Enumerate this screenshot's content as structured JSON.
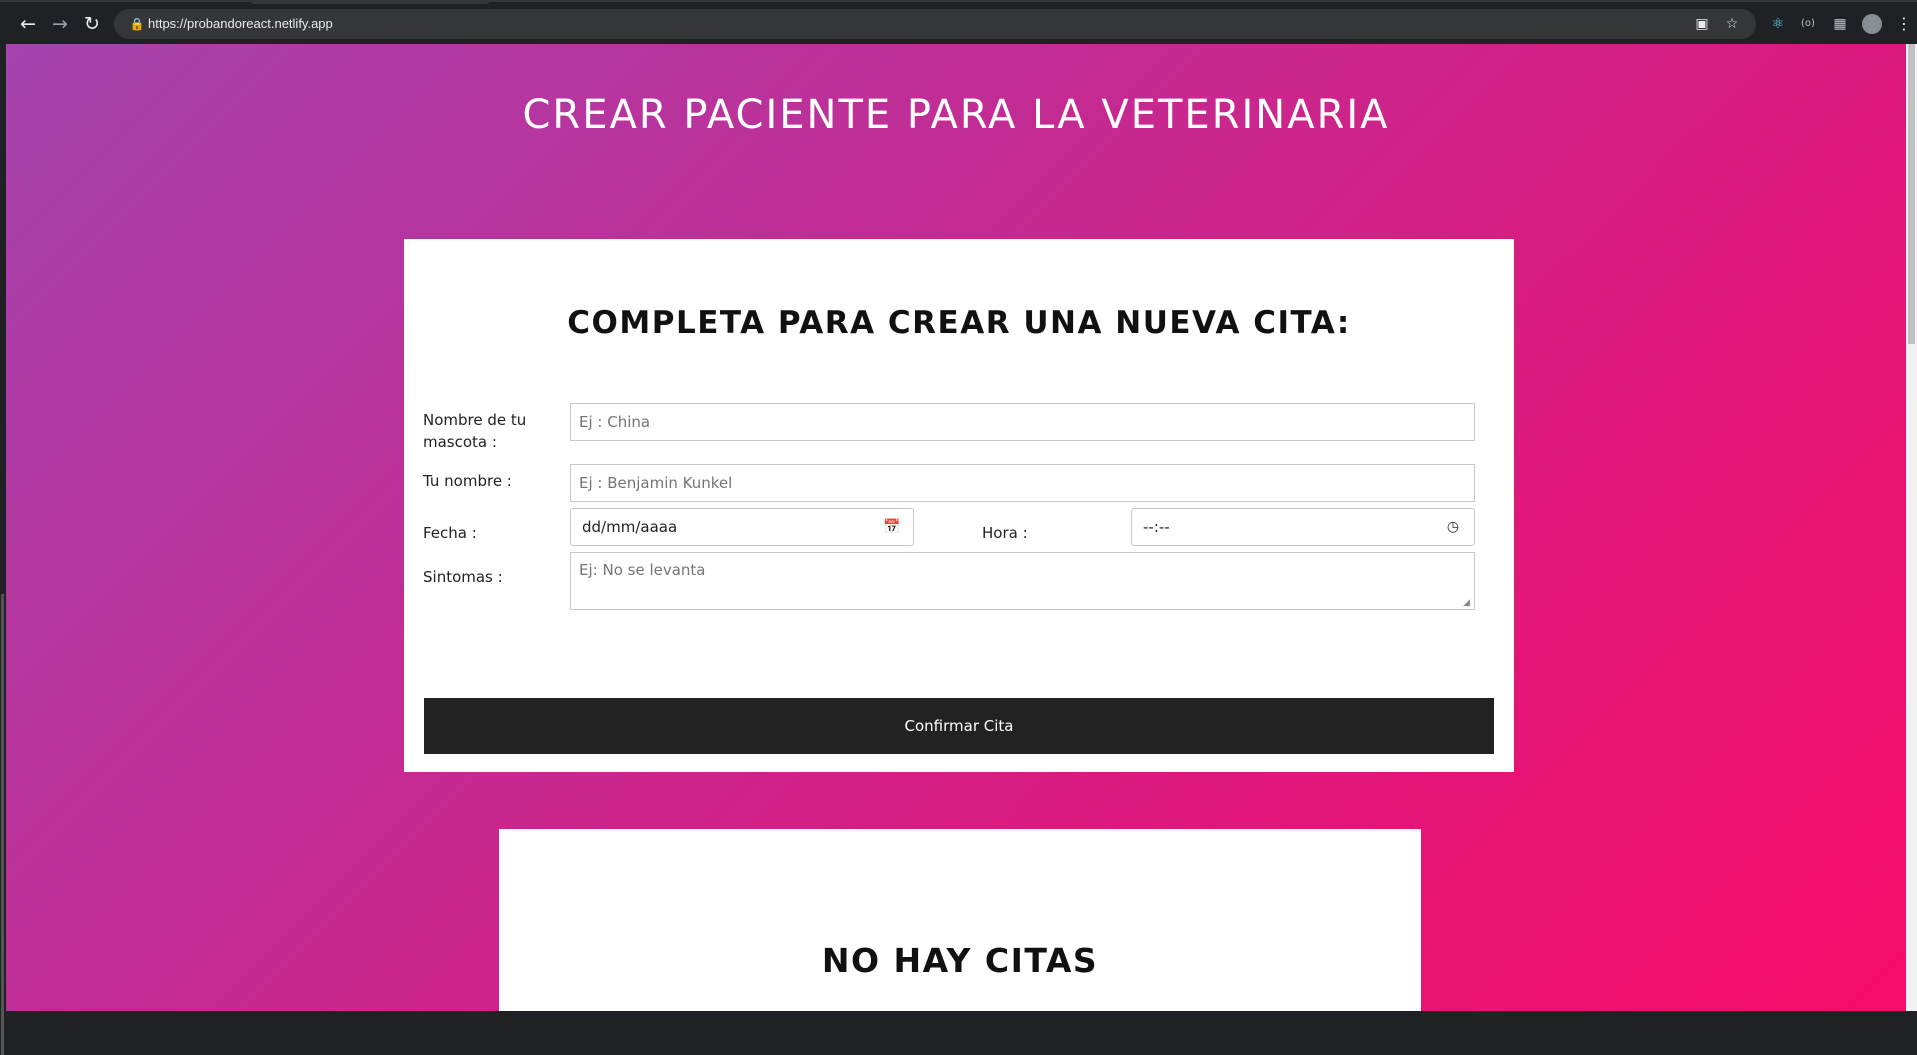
{
  "browser": {
    "url": "https://probandoreact.netlify.app",
    "icons": [
      "back-icon",
      "forward-icon",
      "reload-icon",
      "lock-icon",
      "install-app-icon",
      "star-icon",
      "react-devtools-icon",
      "extension-icon",
      "puzzle-icon",
      "profile-avatar",
      "menu-icon"
    ]
  },
  "page": {
    "title": "CREAR PACIENTE PARA LA VETERINARIA"
  },
  "form": {
    "title": "COMPLETA PARA CREAR UNA NUEVA CITA:",
    "pet_label": "Nombre de tu mascota :",
    "pet_placeholder": "Ej : China",
    "owner_label": "Tu nombre :",
    "owner_placeholder": "Ej : Benjamin Kunkel",
    "date_label": "Fecha :",
    "date_value": "dd/mm/aaaa",
    "time_label": "Hora :",
    "time_value": "--:--",
    "symptoms_label": "Sintomas :",
    "symptoms_placeholder": "Ej: No se levanta",
    "submit_label": "Confirmar Cita"
  },
  "appointments": {
    "empty_title": "NO HAY CITAS"
  },
  "colors": {
    "gradient_start": "#a543ae",
    "gradient_end": "#f70c6a",
    "button_bg": "#222222"
  }
}
